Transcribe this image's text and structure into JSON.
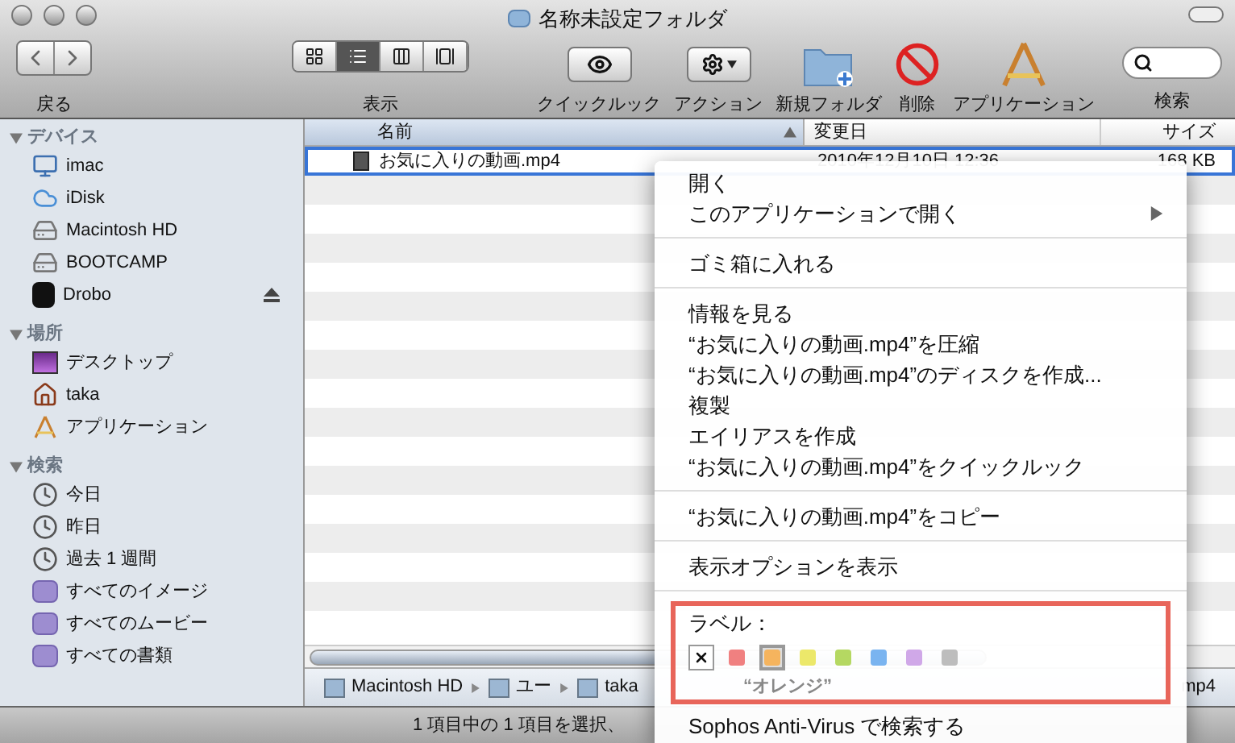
{
  "window": {
    "title": "名称未設定フォルダ"
  },
  "toolbar": {
    "nav_label": "戻る",
    "view_label": "表示",
    "view_modes": [
      {
        "kind": "icon",
        "selected": false
      },
      {
        "kind": "list",
        "selected": true
      },
      {
        "kind": "column",
        "selected": false
      },
      {
        "kind": "coverflow",
        "selected": false
      }
    ],
    "buttons": [
      {
        "kind": "quicklook",
        "label": "クイックルック"
      },
      {
        "kind": "action",
        "label": "アクション"
      },
      {
        "kind": "newfolder",
        "label": "新規フォルダ"
      },
      {
        "kind": "delete",
        "label": "削除"
      },
      {
        "kind": "apps",
        "label": "アプリケーション"
      }
    ],
    "search_label": "検索"
  },
  "sidebar": {
    "sections": [
      {
        "title": "デバイス",
        "items": [
          {
            "kind": "imac",
            "label": "imac"
          },
          {
            "kind": "idisk",
            "label": "iDisk"
          },
          {
            "kind": "disk",
            "label": "Macintosh HD"
          },
          {
            "kind": "disk",
            "label": "BOOTCAMP"
          },
          {
            "kind": "drobo",
            "label": "Drobo",
            "eject": true
          }
        ]
      },
      {
        "title": "場所",
        "items": [
          {
            "kind": "desktop",
            "label": "デスクトップ"
          },
          {
            "kind": "home",
            "label": "taka"
          },
          {
            "kind": "apps",
            "label": "アプリケーション"
          }
        ]
      },
      {
        "title": "検索",
        "items": [
          {
            "kind": "clock",
            "label": "今日"
          },
          {
            "kind": "clock",
            "label": "昨日"
          },
          {
            "kind": "clock",
            "label": "過去 1 週間"
          },
          {
            "kind": "smart",
            "label": "すべてのイメージ"
          },
          {
            "kind": "smart",
            "label": "すべてのムービー"
          },
          {
            "kind": "smart",
            "label": "すべての書類"
          }
        ]
      }
    ]
  },
  "table": {
    "columns": [
      "名前",
      "変更日",
      "サイズ"
    ],
    "rows": [
      {
        "name": "お気に入りの動画.mp4",
        "modified": "2010年12月10日 12:36",
        "size": "168 KB",
        "selected": true
      }
    ]
  },
  "context_menu": {
    "groups": [
      [
        {
          "label": "開く",
          "submenu": false
        },
        {
          "label": "このアプリケーションで開く",
          "submenu": true
        }
      ],
      [
        {
          "label": "ゴミ箱に入れる",
          "submenu": false
        }
      ],
      [
        {
          "label": "情報を見る",
          "submenu": false
        },
        {
          "label": "“お気に入りの動画.mp4”を圧縮",
          "submenu": false
        },
        {
          "label": "“お気に入りの動画.mp4”のディスクを作成...",
          "submenu": false
        },
        {
          "label": "複製",
          "submenu": false
        },
        {
          "label": "エイリアスを作成",
          "submenu": false
        },
        {
          "label": "“お気に入りの動画.mp4”をクイックルック",
          "submenu": false
        }
      ],
      [
        {
          "label": "“お気に入りの動画.mp4”をコピー",
          "submenu": false
        }
      ],
      [
        {
          "label": "表示オプションを表示",
          "submenu": false
        }
      ]
    ],
    "label_section": {
      "title": "ラベル：",
      "colors": [
        {
          "kind": "none",
          "selected": false
        },
        {
          "kind": "color",
          "color": "#f08080",
          "selected": false
        },
        {
          "kind": "color",
          "color": "#f5b45e",
          "selected": true
        },
        {
          "kind": "color",
          "color": "#ece86a",
          "selected": false
        },
        {
          "kind": "color",
          "color": "#b5d862",
          "selected": false
        },
        {
          "kind": "color",
          "color": "#7ab4f0",
          "selected": false
        },
        {
          "kind": "color",
          "color": "#d0a8e8",
          "selected": false
        },
        {
          "kind": "color",
          "color": "#bdbdbd",
          "selected": false
        }
      ],
      "hover_name": "“オレンジ”"
    },
    "after": [
      {
        "label": "Sophos Anti-Virus で検索する",
        "submenu": false
      }
    ]
  },
  "path_bar": {
    "items": [
      "Macintosh HD",
      "ユー",
      "taka"
    ],
    "tail": "mp4"
  },
  "status_bar": "1 項目中の 1 項目を選択、"
}
